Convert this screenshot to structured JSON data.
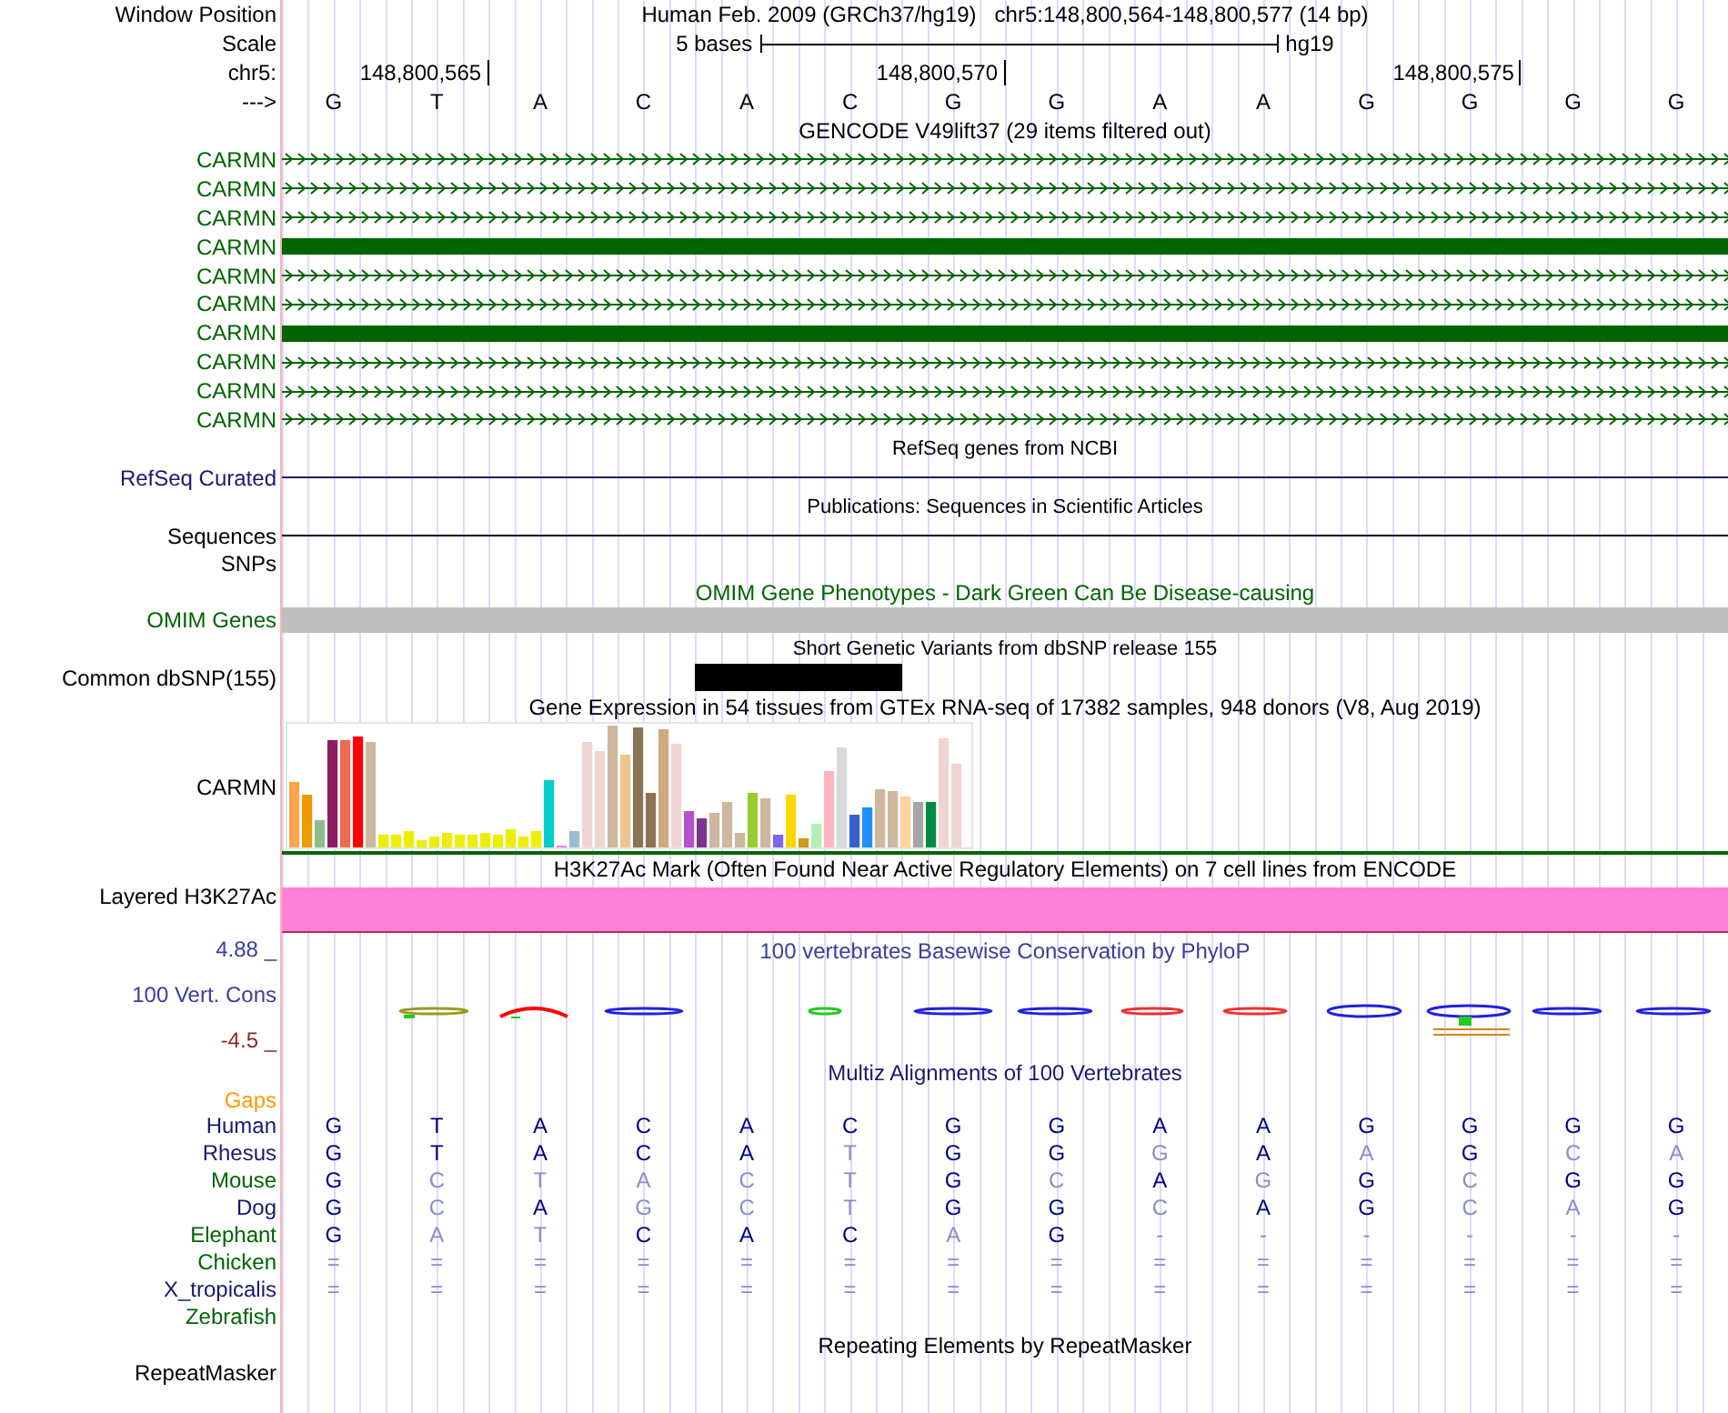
{
  "header": {
    "window_label": "Window Position",
    "window_text": "Human Feb. 2009 (GRCh37/hg19)   chr5:148,800,564-148,800,577 (14 bp)",
    "scale_label": "Scale",
    "scale_text": "5 bases",
    "scale_assembly": "hg19",
    "chrom_label": "chr5:",
    "strand_label": "--->"
  },
  "sequence": [
    {
      "base": "G"
    },
    {
      "base": "T",
      "tick": "148,800,565"
    },
    {
      "base": "A"
    },
    {
      "base": "C"
    },
    {
      "base": "A"
    },
    {
      "base": "C"
    },
    {
      "base": "G",
      "tick": "148,800,570"
    },
    {
      "base": "G"
    },
    {
      "base": "A"
    },
    {
      "base": "A"
    },
    {
      "base": "G"
    },
    {
      "base": "G",
      "tick": "148,800,575"
    },
    {
      "base": "G"
    },
    {
      "base": "G"
    }
  ],
  "tracks": [
    {
      "kind": "genes",
      "title": {
        "text": "GENCODE V49lift37 (29 items filtered out)",
        "color": "#000000",
        "small": false
      },
      "items": [
        {
          "label": "CARMN",
          "kind": "arrows"
        },
        {
          "label": "CARMN",
          "kind": "arrows"
        },
        {
          "label": "CARMN",
          "kind": "arrows"
        },
        {
          "label": "CARMN",
          "kind": "block"
        },
        {
          "label": "CARMN",
          "kind": "arrows"
        },
        {
          "label": "CARMN",
          "kind": "arrows"
        },
        {
          "label": "CARMN",
          "kind": "block"
        },
        {
          "label": "CARMN",
          "kind": "arrows"
        },
        {
          "label": "CARMN",
          "kind": "arrows"
        },
        {
          "label": "CARMN",
          "kind": "arrows"
        }
      ]
    },
    {
      "kind": "line",
      "title": {
        "text": "RefSeq genes from NCBI",
        "color": "#000000",
        "small": true
      },
      "label": "RefSeq Curated",
      "color": "#191970"
    },
    {
      "kind": "line",
      "title": {
        "text": "Publications: Sequences in Scientific Articles",
        "color": "#000000",
        "small": true
      },
      "label": "Sequences",
      "color": "#000000"
    },
    {
      "kind": "empty",
      "label": "SNPs",
      "color": "#000000"
    },
    {
      "kind": "bar",
      "title": {
        "text": "OMIM Gene Phenotypes - Dark Green Can Be Disease-causing",
        "color": "#006400",
        "small": false
      },
      "label": "OMIM Genes",
      "color": "#006400"
    },
    {
      "kind": "variants",
      "title": {
        "text": "Short Genetic Variants from dbSNP release 155",
        "color": "#000000",
        "small": true
      },
      "label": "Common dbSNP(155)",
      "color": "#000000",
      "positions": [
        {
          "filled": false
        },
        {
          "filled": false
        },
        {
          "filled": false
        },
        {
          "filled": false
        },
        {
          "filled": true
        },
        {
          "filled": true
        },
        {
          "filled": false
        },
        {
          "filled": false
        },
        {
          "filled": false
        },
        {
          "filled": false
        },
        {
          "filled": false
        },
        {
          "filled": false
        },
        {
          "filled": false
        },
        {
          "filled": false
        }
      ]
    },
    {
      "kind": "chart",
      "title": {
        "text": "Gene Expression in 54 tissues from GTEx RNA-seq of 17382 samples, 948 donors (V8, Aug 2019)",
        "color": "#000000",
        "small": false
      },
      "label": "CARMN",
      "color": "#000000"
    },
    {
      "kind": "density",
      "title": {
        "text": "H3K27Ac Mark (Often Found Near Active Regulatory Elements) on 7 cell lines from ENCODE",
        "color": "#000000",
        "small": false
      },
      "label": "Layered H3K27Ac",
      "color": "#000000"
    },
    {
      "kind": "wiggle",
      "title": {
        "text": "100 vertebrates Basewise Conservation by PhyloP",
        "color": "#3c3c9c",
        "small": false
      },
      "label": "100 Vert. Cons",
      "color": "#3c3c9c",
      "max": "4.88 _",
      "min": "-4.5 _"
    },
    {
      "kind": "multiz",
      "title": {
        "text": "Multiz Alignments of 100 Vertebrates",
        "color": "#191970",
        "small": false
      },
      "gaps_label": "Gaps",
      "species": [
        {
          "name": "Human",
          "color": "#191970",
          "cells": [
            {
              "text": "G",
              "conserved": true
            },
            {
              "text": "T",
              "conserved": true
            },
            {
              "text": "A",
              "conserved": true
            },
            {
              "text": "C",
              "conserved": true
            },
            {
              "text": "A",
              "conserved": true
            },
            {
              "text": "C",
              "conserved": true
            },
            {
              "text": "G",
              "conserved": true
            },
            {
              "text": "G",
              "conserved": true
            },
            {
              "text": "A",
              "conserved": true
            },
            {
              "text": "A",
              "conserved": true
            },
            {
              "text": "G",
              "conserved": true
            },
            {
              "text": "G",
              "conserved": true
            },
            {
              "text": "G",
              "conserved": true
            },
            {
              "text": "G",
              "conserved": true
            }
          ]
        },
        {
          "name": "Rhesus",
          "color": "#191970",
          "cells": [
            {
              "text": "G",
              "conserved": true
            },
            {
              "text": "T",
              "conserved": true
            },
            {
              "text": "A",
              "conserved": true
            },
            {
              "text": "C",
              "conserved": true
            },
            {
              "text": "A",
              "conserved": true
            },
            {
              "text": "T",
              "conserved": false
            },
            {
              "text": "G",
              "conserved": true
            },
            {
              "text": "G",
              "conserved": true
            },
            {
              "text": "G",
              "conserved": false
            },
            {
              "text": "A",
              "conserved": true
            },
            {
              "text": "A",
              "conserved": false
            },
            {
              "text": "G",
              "conserved": true
            },
            {
              "text": "C",
              "conserved": false
            },
            {
              "text": "A",
              "conserved": false
            }
          ]
        },
        {
          "name": "Mouse",
          "color": "#006400",
          "cells": [
            {
              "text": "G",
              "conserved": true
            },
            {
              "text": "C",
              "conserved": false
            },
            {
              "text": "T",
              "conserved": false
            },
            {
              "text": "A",
              "conserved": false
            },
            {
              "text": "C",
              "conserved": false
            },
            {
              "text": "T",
              "conserved": false
            },
            {
              "text": "G",
              "conserved": true
            },
            {
              "text": "C",
              "conserved": false
            },
            {
              "text": "A",
              "conserved": true
            },
            {
              "text": "G",
              "conserved": false
            },
            {
              "text": "G",
              "conserved": true
            },
            {
              "text": "C",
              "conserved": false
            },
            {
              "text": "G",
              "conserved": true
            },
            {
              "text": "G",
              "conserved": true
            }
          ]
        },
        {
          "name": "Dog",
          "color": "#191970",
          "cells": [
            {
              "text": "G",
              "conserved": true
            },
            {
              "text": "C",
              "conserved": false
            },
            {
              "text": "A",
              "conserved": true
            },
            {
              "text": "G",
              "conserved": false
            },
            {
              "text": "C",
              "conserved": false
            },
            {
              "text": "T",
              "conserved": false
            },
            {
              "text": "G",
              "conserved": true
            },
            {
              "text": "G",
              "conserved": true
            },
            {
              "text": "C",
              "conserved": false
            },
            {
              "text": "A",
              "conserved": true
            },
            {
              "text": "G",
              "conserved": true
            },
            {
              "text": "C",
              "conserved": false
            },
            {
              "text": "A",
              "conserved": false
            },
            {
              "text": "G",
              "conserved": true
            }
          ]
        },
        {
          "name": "Elephant",
          "color": "#006400",
          "cells": [
            {
              "text": "G",
              "conserved": true
            },
            {
              "text": "A",
              "conserved": false
            },
            {
              "text": "T",
              "conserved": false
            },
            {
              "text": "C",
              "conserved": true
            },
            {
              "text": "A",
              "conserved": true
            },
            {
              "text": "C",
              "conserved": true
            },
            {
              "text": "A",
              "conserved": false
            },
            {
              "text": "G",
              "conserved": true
            },
            {
              "text": "-",
              "conserved": false
            },
            {
              "text": "-",
              "conserved": false
            },
            {
              "text": "-",
              "conserved": false
            },
            {
              "text": "-",
              "conserved": false
            },
            {
              "text": "-",
              "conserved": false
            },
            {
              "text": "-",
              "conserved": false
            }
          ]
        },
        {
          "name": "Chicken",
          "color": "#006400",
          "cells": [
            {
              "text": "=",
              "conserved": false
            },
            {
              "text": "=",
              "conserved": false
            },
            {
              "text": "=",
              "conserved": false
            },
            {
              "text": "=",
              "conserved": false
            },
            {
              "text": "=",
              "conserved": false
            },
            {
              "text": "=",
              "conserved": false
            },
            {
              "text": "=",
              "conserved": false
            },
            {
              "text": "=",
              "conserved": false
            },
            {
              "text": "=",
              "conserved": false
            },
            {
              "text": "=",
              "conserved": false
            },
            {
              "text": "=",
              "conserved": false
            },
            {
              "text": "=",
              "conserved": false
            },
            {
              "text": "=",
              "conserved": false
            },
            {
              "text": "=",
              "conserved": false
            }
          ]
        },
        {
          "name": "X_tropicalis",
          "color": "#191970",
          "cells": [
            {
              "text": "=",
              "conserved": false
            },
            {
              "text": "=",
              "conserved": false
            },
            {
              "text": "=",
              "conserved": false
            },
            {
              "text": "=",
              "conserved": false
            },
            {
              "text": "=",
              "conserved": false
            },
            {
              "text": "=",
              "conserved": false
            },
            {
              "text": "=",
              "conserved": false
            },
            {
              "text": "=",
              "conserved": false
            },
            {
              "text": "=",
              "conserved": false
            },
            {
              "text": "=",
              "conserved": false
            },
            {
              "text": "=",
              "conserved": false
            },
            {
              "text": "=",
              "conserved": false
            },
            {
              "text": "=",
              "conserved": false
            },
            {
              "text": "=",
              "conserved": false
            }
          ]
        },
        {
          "name": "Zebrafish",
          "color": "#006400"
        }
      ]
    },
    {
      "kind": "empty_titled",
      "title": {
        "text": "Repeating Elements by RepeatMasker",
        "color": "#000000",
        "small": false
      },
      "label": "RepeatMasker",
      "color": "#000000"
    }
  ]
}
